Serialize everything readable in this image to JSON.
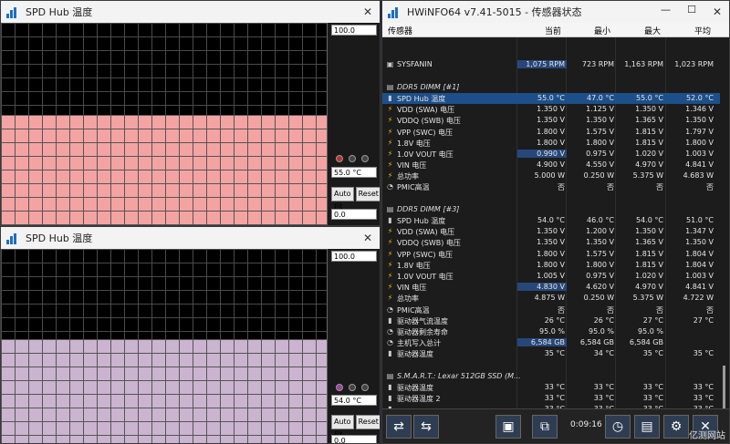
{
  "graph1": {
    "title": "SPD Hub 温度",
    "max": "100.0",
    "cur": "55.0 °C",
    "min": "0.0",
    "auto": "Auto Fit",
    "reset": "Reset",
    "level": 0.55,
    "color": "#f4a3a3"
  },
  "graph2": {
    "title": "SPD Hub 温度",
    "max": "100.0",
    "cur": "54.0 °C",
    "min": "0.0",
    "auto": "Auto Fit",
    "reset": "Reset",
    "level": 0.54,
    "color": "#cbb4d0"
  },
  "main": {
    "title": "HWiNFO64 v7.41-5015 - 传感器状态",
    "cols": [
      "传感器",
      "当前",
      "最小",
      "最大",
      "平均"
    ],
    "rows": [
      {
        "n": "",
        "c": "",
        "mi": "",
        "ma": "",
        "a": ""
      },
      {
        "n": "",
        "c": "",
        "mi": "",
        "ma": "",
        "a": ""
      },
      {
        "n": "SYSFANIN",
        "c": "1,075 RPM",
        "mi": "723 RPM",
        "ma": "1,163 RPM",
        "a": "1,023 RPM",
        "i": "▣",
        "hc": 1
      },
      {
        "n": "",
        "c": "",
        "mi": "",
        "ma": "",
        "a": ""
      },
      {
        "n": "DDR5 DIMM [#1]",
        "c": "",
        "mi": "",
        "ma": "",
        "a": "",
        "i": "▤",
        "g": 1
      },
      {
        "n": "SPD Hub 温度",
        "c": "55.0 °C",
        "mi": "47.0 °C",
        "ma": "55.0 °C",
        "a": "52.0 °C",
        "i": "🌡",
        "h": 1
      },
      {
        "n": "VDD (SWA) 电压",
        "c": "1.350 V",
        "mi": "1.125 V",
        "ma": "1.350 V",
        "a": "1.346 V",
        "i": "⚡"
      },
      {
        "n": "VDDQ (SWB) 电压",
        "c": "1.350 V",
        "mi": "1.350 V",
        "ma": "1.365 V",
        "a": "1.350 V",
        "i": "⚡"
      },
      {
        "n": "VPP (SWC) 电压",
        "c": "1.800 V",
        "mi": "1.575 V",
        "ma": "1.815 V",
        "a": "1.797 V",
        "i": "⚡"
      },
      {
        "n": "1.8V 电压",
        "c": "1.800 V",
        "mi": "1.800 V",
        "ma": "1.815 V",
        "a": "1.800 V",
        "i": "⚡"
      },
      {
        "n": "1.0V VOUT 电压",
        "c": "0.990 V",
        "mi": "0.975 V",
        "ma": "1.020 V",
        "a": "1.003 V",
        "i": "⚡",
        "hc": 1
      },
      {
        "n": "VIN 电压",
        "c": "4.900 V",
        "mi": "4.550 V",
        "ma": "4.970 V",
        "a": "4.841 V",
        "i": "⚡"
      },
      {
        "n": "总功率",
        "c": "5.000 W",
        "mi": "0.250 W",
        "ma": "5.375 W",
        "a": "4.683 W",
        "i": "⚡"
      },
      {
        "n": "PMIC高温",
        "c": "否",
        "mi": "否",
        "ma": "否",
        "a": "否",
        "i": "◔"
      },
      {
        "n": "",
        "c": "",
        "mi": "",
        "ma": "",
        "a": ""
      },
      {
        "n": "DDR5 DIMM [#3]",
        "c": "",
        "mi": "",
        "ma": "",
        "a": "",
        "i": "▤",
        "g": 1
      },
      {
        "n": "SPD Hub 温度",
        "c": "54.0 °C",
        "mi": "46.0 °C",
        "ma": "54.0 °C",
        "a": "51.0 °C",
        "i": "🌡"
      },
      {
        "n": "VDD (SWA) 电压",
        "c": "1.350 V",
        "mi": "1.200 V",
        "ma": "1.350 V",
        "a": "1.347 V",
        "i": "⚡"
      },
      {
        "n": "VDDQ (SWB) 电压",
        "c": "1.350 V",
        "mi": "1.350 V",
        "ma": "1.365 V",
        "a": "1.350 V",
        "i": "⚡"
      },
      {
        "n": "VPP (SWC) 电压",
        "c": "1.800 V",
        "mi": "1.575 V",
        "ma": "1.815 V",
        "a": "1.804 V",
        "i": "⚡"
      },
      {
        "n": "1.8V 电压",
        "c": "1.800 V",
        "mi": "1.800 V",
        "ma": "1.815 V",
        "a": "1.804 V",
        "i": "⚡"
      },
      {
        "n": "1.0V VOUT 电压",
        "c": "1.005 V",
        "mi": "0.975 V",
        "ma": "1.020 V",
        "a": "1.003 V",
        "i": "⚡"
      },
      {
        "n": "VIN 电压",
        "c": "4.830 V",
        "mi": "4.620 V",
        "ma": "4.970 V",
        "a": "4.841 V",
        "i": "⚡",
        "hc": 1
      },
      {
        "n": "总功率",
        "c": "4.875 W",
        "mi": "0.250 W",
        "ma": "5.375 W",
        "a": "4.722 W",
        "i": "⚡"
      },
      {
        "n": "PMIC高温",
        "c": "否",
        "mi": "否",
        "ma": "否",
        "a": "否",
        "i": "◔"
      },
      {
        "n": "驱动器气流温度",
        "c": "26 °C",
        "mi": "26 °C",
        "ma": "27 °C",
        "a": "27 °C",
        "i": "🌡"
      },
      {
        "n": "驱动器剩余寿命",
        "c": "95.0 %",
        "mi": "95.0 %",
        "ma": "95.0 %",
        "a": "",
        "i": "◔"
      },
      {
        "n": "主机写入总计",
        "c": "6,584 GB",
        "mi": "6,584 GB",
        "ma": "6,584 GB",
        "a": "",
        "i": "◔",
        "hc": 1
      },
      {
        "n": "驱动器温度",
        "c": "35 °C",
        "mi": "34 °C",
        "ma": "35 °C",
        "a": "35 °C",
        "i": "🌡"
      },
      {
        "n": "",
        "c": "",
        "mi": "",
        "ma": "",
        "a": ""
      },
      {
        "n": "S.M.A.R.T.: Lexar 512GB SSD (M...",
        "c": "",
        "mi": "",
        "ma": "",
        "a": "",
        "i": "▤",
        "g": 1
      },
      {
        "n": "驱动器温度",
        "c": "33 °C",
        "mi": "33 °C",
        "ma": "33 °C",
        "a": "33 °C",
        "i": "🌡"
      },
      {
        "n": "驱动器温度 2",
        "c": "33 °C",
        "mi": "33 °C",
        "ma": "33 °C",
        "a": "33 °C",
        "i": "🌡"
      },
      {
        "n": "",
        "c": "33 °C",
        "mi": "33 °C",
        "ma": "33 °C",
        "a": "33 °C",
        "i": "🌡"
      }
    ],
    "timer": "0:09:16",
    "watermark": "亿测网站"
  }
}
